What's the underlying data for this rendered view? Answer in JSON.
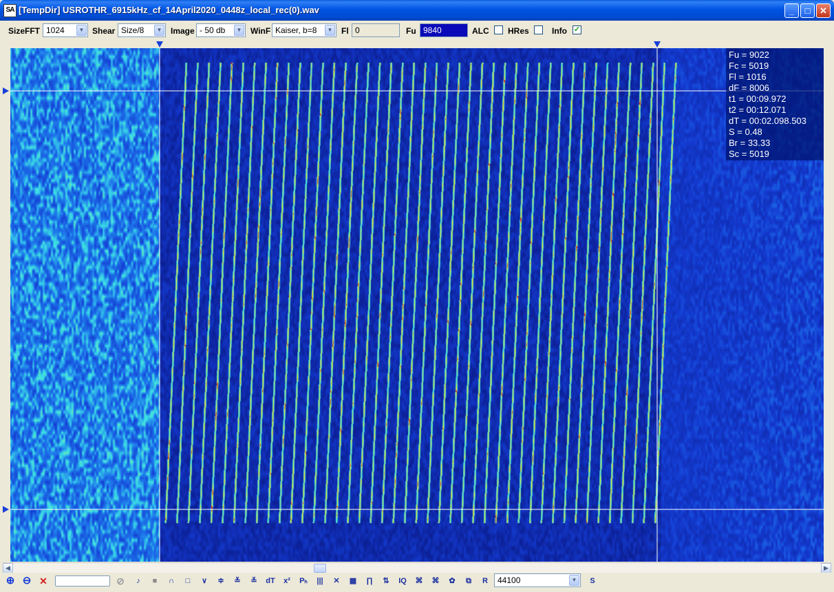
{
  "window": {
    "app_icon_text": "SA",
    "title": "[TempDir] USROTHR_6915kHz_cf_14April2020_0448z_local_rec(0).wav",
    "minimize": "_",
    "maximize": "□",
    "close": "✕"
  },
  "toolbar": {
    "sizefft_label": "SizeFFT",
    "sizefft_value": "1024",
    "shear_label": "Shear",
    "shear_value": "Size/8",
    "image_label": "Image",
    "image_value": "- 50 db",
    "winf_label": "WinF",
    "winf_value": "Kaiser, b=8",
    "fl_label": "Fl",
    "fl_value": "0",
    "fu_label": "Fu",
    "fu_value": "9840",
    "alc_label": "ALC",
    "alc_checked": false,
    "hres_label": "HRes",
    "hres_checked": false,
    "info_label": "Info",
    "info_checked": true,
    "check_mark": "✓",
    "dropdown_arrow": "▼"
  },
  "info": {
    "fu": "Fu = 9022",
    "fc": "Fc = 5019",
    "fl": "Fl = 1016",
    "df": "dF = 8006",
    "t1": "t1 = 00:09.972",
    "t2": "t2 = 00:12.071",
    "dt": "dT = 00:02.098.503",
    "s": "S = 0.48",
    "br": "Br = 33.33",
    "sc": "Sc = 5019"
  },
  "spectrogram": {
    "chirp_count": 44,
    "colors": {
      "background": "#0a1f9e",
      "noise": "#1e6fe0",
      "trace": "#3ee6e6",
      "peak": "#ffd000",
      "cursor": "#ffffff"
    }
  },
  "scrollbar": {
    "left_arrow": "◀",
    "right_arrow": "▶"
  },
  "bottombar": {
    "zoom_in": "⊕",
    "zoom_out": "⊖",
    "zoom_cancel": "✕",
    "no_icon": "⊘",
    "speaker": "♪",
    "stop": "■",
    "t_arc": "∩",
    "t_rect": "□",
    "t_v": "∨",
    "t_a": "≑",
    "t_b": "≚",
    "t_c": "≚",
    "dt": "dT",
    "x2": "x²",
    "ph": "Pₕ",
    "bars": "|||",
    "cross": "✕",
    "grid": "▦",
    "pulse": "∏",
    "updown": "⇅",
    "iq": "IQ",
    "g1": "⌘",
    "g2": "⌘",
    "gear": "✿",
    "copy": "⧉",
    "r": "R",
    "sample_rate": "44100",
    "s": "S"
  }
}
